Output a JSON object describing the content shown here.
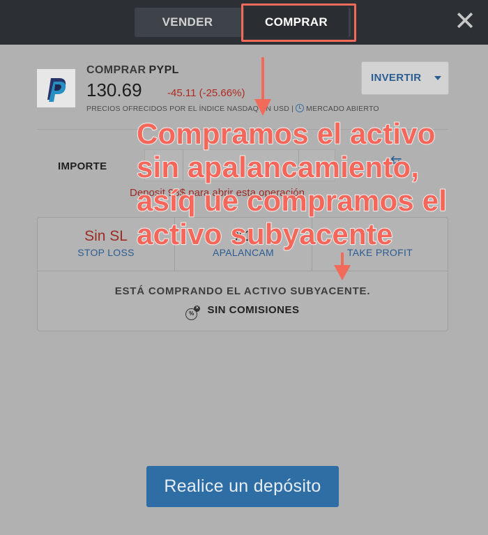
{
  "header": {
    "tabs": [
      {
        "label": "VENDER"
      },
      {
        "label": "COMPRAR"
      }
    ],
    "close_glyph": "✕"
  },
  "instrument": {
    "action": "COMPRAR",
    "symbol": "PYPL",
    "price": "130.69",
    "change": "-45.11 (-25.66%)",
    "source_text": "PRECIOS OFRECIDOS POR EL ÍNDICE NASDAQ EN USD |",
    "market_status": "MERCADO ABIERTO",
    "logo_icon": "paypal-logo"
  },
  "invest_button": {
    "label": "INVERTIR"
  },
  "order": {
    "amount_label": "IMPORTE",
    "deposit_message": "Deposit 93$ para abrir esta operación"
  },
  "settings": {
    "stop_loss": {
      "value": "Sin SL",
      "label": "STOP LOSS"
    },
    "leverage": {
      "value": "X1",
      "label": "APALANCAM"
    },
    "take_profit": {
      "value": "",
      "label": "TAKE PROFIT"
    }
  },
  "notes": {
    "underlying": "ESTÁ COMPRANDO EL ACTIVO SUBYACENTE.",
    "commission": "SIN COMISIONES"
  },
  "deposit_button": {
    "label": "Realice un depósito"
  },
  "annotation": {
    "text_lines": [
      "Compramos el activo",
      "sin apalancamiento,",
      "asíq ue compramos el",
      "activo subyacente"
    ],
    "color": "#f5675a"
  },
  "colors": {
    "topbar": "#2c2f33",
    "accent_blue": "#2b5d93",
    "loss_red": "#b02a22",
    "highlight": "#f26a5a"
  }
}
